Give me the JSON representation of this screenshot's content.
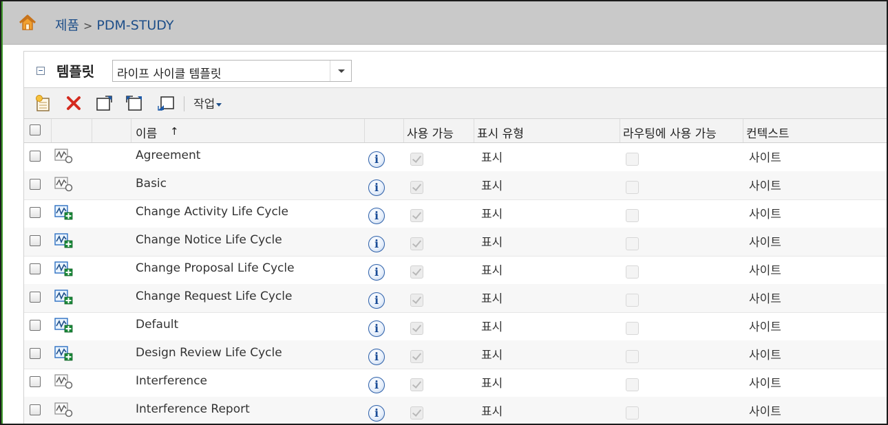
{
  "breadcrumb": {
    "root": "제품",
    "separator": ">",
    "current": "PDM-STUDY"
  },
  "template": {
    "label": "템플릿",
    "selected": "라이프 사이클 템플릿",
    "collapse_symbol": "−"
  },
  "toolbar": {
    "actions_label": "작업"
  },
  "columns": {
    "name": "이름",
    "sort_indicator": "↑",
    "enabled": "사용 가능",
    "display_type": "표시 유형",
    "routing": "라우팅에 사용 가능",
    "context": "컨텍스트"
  },
  "info_glyph": "i",
  "colors": {
    "link": "#1d4e89",
    "header": "#c9c9c9",
    "home_icon": "#e08a1c"
  },
  "rows": [
    {
      "name": "Agreement",
      "icon": "lifecycle-basic-icon",
      "enabled": true,
      "display_type": "표시",
      "routing": false,
      "context": "사이트"
    },
    {
      "name": "Basic",
      "icon": "lifecycle-basic-icon",
      "enabled": true,
      "display_type": "표시",
      "routing": false,
      "context": "사이트"
    },
    {
      "name": "Change Activity Life Cycle",
      "icon": "lifecycle-advanced-icon",
      "enabled": true,
      "display_type": "표시",
      "routing": false,
      "context": "사이트"
    },
    {
      "name": "Change Notice Life Cycle",
      "icon": "lifecycle-advanced-icon",
      "enabled": true,
      "display_type": "표시",
      "routing": false,
      "context": "사이트"
    },
    {
      "name": "Change Proposal Life Cycle",
      "icon": "lifecycle-advanced-icon",
      "enabled": true,
      "display_type": "표시",
      "routing": false,
      "context": "사이트"
    },
    {
      "name": "Change Request Life Cycle",
      "icon": "lifecycle-advanced-icon",
      "enabled": true,
      "display_type": "표시",
      "routing": false,
      "context": "사이트"
    },
    {
      "name": "Default",
      "icon": "lifecycle-advanced-icon",
      "enabled": true,
      "display_type": "표시",
      "routing": false,
      "context": "사이트"
    },
    {
      "name": "Design Review Life Cycle",
      "icon": "lifecycle-advanced-icon",
      "enabled": true,
      "display_type": "표시",
      "routing": false,
      "context": "사이트"
    },
    {
      "name": "Interference",
      "icon": "lifecycle-basic-icon",
      "enabled": true,
      "display_type": "표시",
      "routing": false,
      "context": "사이트"
    },
    {
      "name": "Interference Report",
      "icon": "lifecycle-basic-icon",
      "enabled": true,
      "display_type": "표시",
      "routing": false,
      "context": "사이트"
    }
  ]
}
